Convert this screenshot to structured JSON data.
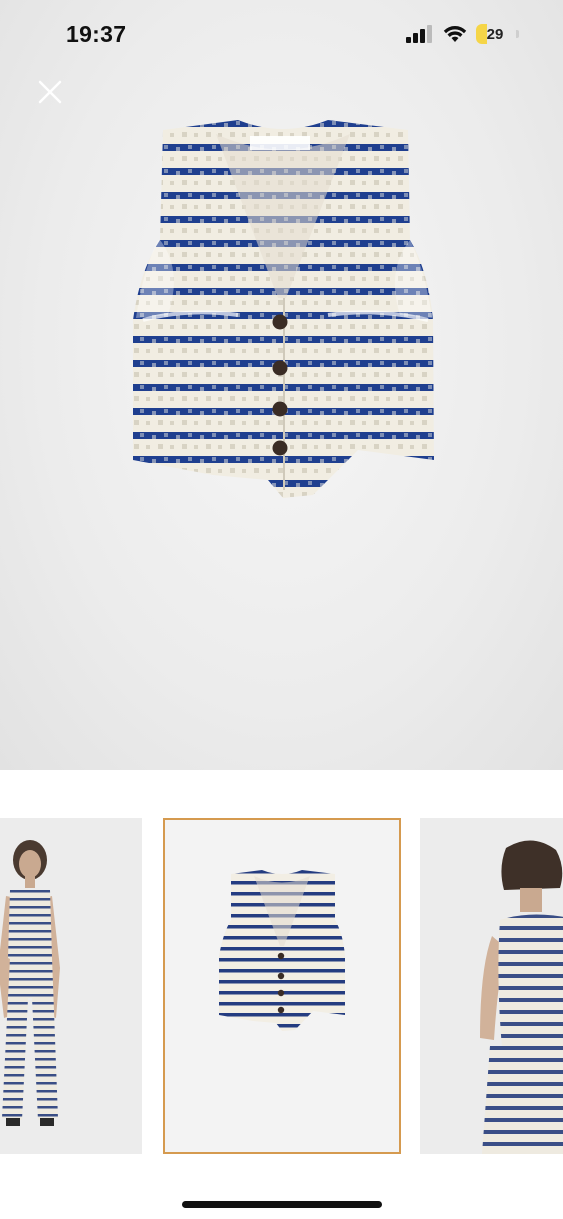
{
  "status_bar": {
    "time": "19:37",
    "battery_percent": "29",
    "battery_level": 0.29,
    "icons": [
      "cellular-signal-icon",
      "wifi-icon",
      "battery-icon"
    ]
  },
  "viewer": {
    "close_icon": "close-icon",
    "selected_thumbnail_index": 1,
    "selected_border_color": "#d59a4f"
  },
  "thumbnails": [
    {
      "name": "model-front"
    },
    {
      "name": "vest-flat"
    },
    {
      "name": "model-back"
    }
  ],
  "colors": {
    "stripe_navy": "#1f3f8f",
    "fabric_cream": "#f1ede2",
    "button_brown": "#3a2c25"
  }
}
